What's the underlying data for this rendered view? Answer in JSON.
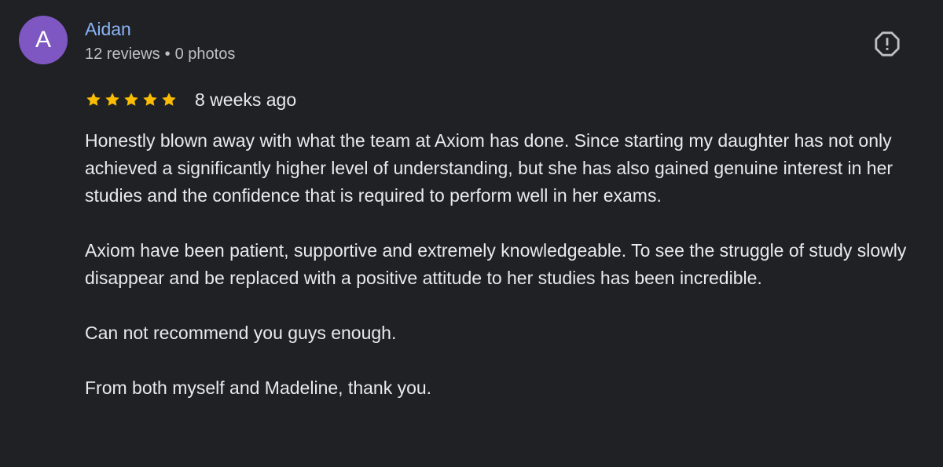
{
  "review": {
    "author": {
      "initial": "A",
      "name": "Aidan",
      "reviews": "12 reviews",
      "separator": "•",
      "photos": "0 photos"
    },
    "rating": {
      "stars": 5,
      "max_stars": 5,
      "star_color": "#fbbc04"
    },
    "date": "8 weeks ago",
    "paragraphs": [
      "Honestly blown away with what the team at Axiom has done. Since starting my daughter has not only achieved a significantly higher level of understanding, but she has also gained genuine interest in her studies and the confidence that is required to perform well in her exams.",
      "Axiom have been patient, supportive and extremely knowledgeable. To see the struggle of study slowly disappear and be replaced with a positive attitude to her studies has been incredible.",
      "Can not recommend you guys enough.",
      "From both myself and Madeline, thank you."
    ]
  },
  "colors": {
    "background": "#202124",
    "avatar": "#7e57c2",
    "author_link": "#8ab4f8",
    "text_primary": "#e8eaed",
    "text_secondary": "#bdc1c6"
  },
  "icons": {
    "report": "report-flag-octagon-icon",
    "star": "star-icon"
  }
}
